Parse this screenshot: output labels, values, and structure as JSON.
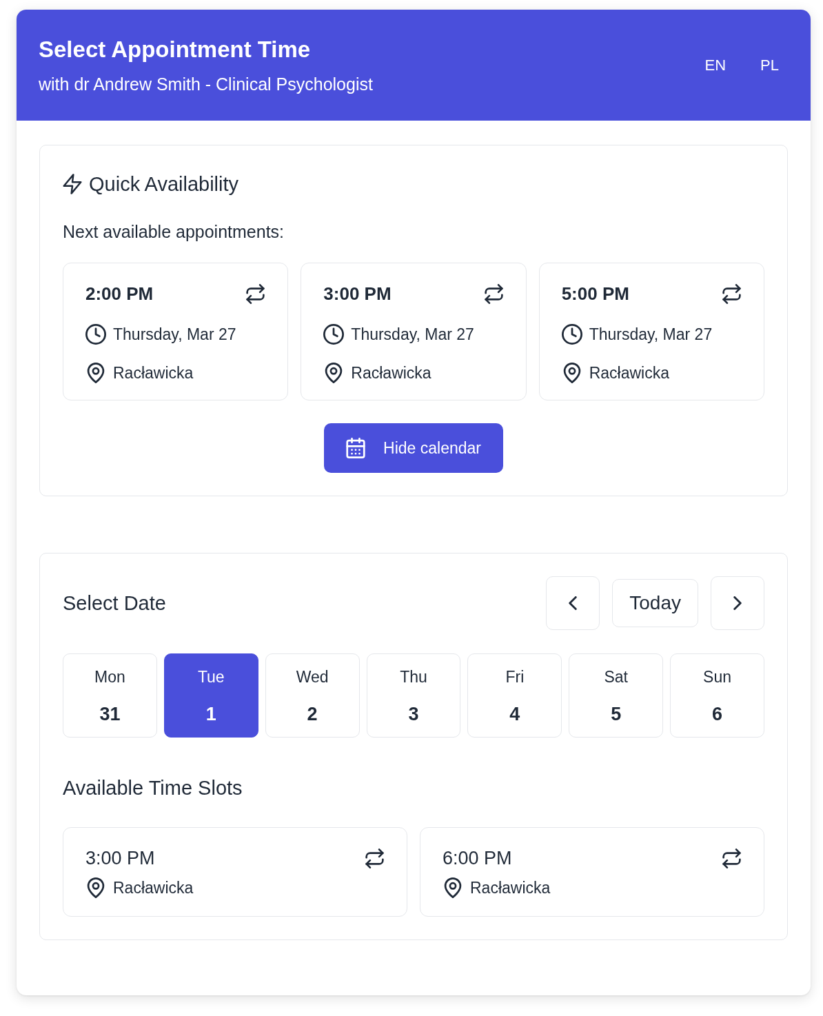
{
  "header": {
    "title": "Select Appointment Time",
    "subtitle": "with dr Andrew Smith - Clinical Psychologist",
    "languages": [
      "EN",
      "PL"
    ]
  },
  "quick_availability": {
    "title": "Quick Availability",
    "subtitle": "Next available appointments:",
    "appointments": [
      {
        "time": "2:00 PM",
        "date": "Thursday, Mar 27",
        "location": "Racławicka"
      },
      {
        "time": "3:00 PM",
        "date": "Thursday, Mar 27",
        "location": "Racławicka"
      },
      {
        "time": "5:00 PM",
        "date": "Thursday, Mar 27",
        "location": "Racławicka"
      }
    ],
    "toggle_button": "Hide calendar"
  },
  "date_picker": {
    "title": "Select Date",
    "today_button": "Today",
    "days": [
      {
        "weekday": "Mon",
        "day": "31",
        "selected": false
      },
      {
        "weekday": "Tue",
        "day": "1",
        "selected": true
      },
      {
        "weekday": "Wed",
        "day": "2",
        "selected": false
      },
      {
        "weekday": "Thu",
        "day": "3",
        "selected": false
      },
      {
        "weekday": "Fri",
        "day": "4",
        "selected": false
      },
      {
        "weekday": "Sat",
        "day": "5",
        "selected": false
      },
      {
        "weekday": "Sun",
        "day": "6",
        "selected": false
      }
    ]
  },
  "time_slots": {
    "title": "Available Time Slots",
    "slots": [
      {
        "time": "3:00 PM",
        "location": "Racławicka"
      },
      {
        "time": "6:00 PM",
        "location": "Racławicka"
      }
    ]
  }
}
